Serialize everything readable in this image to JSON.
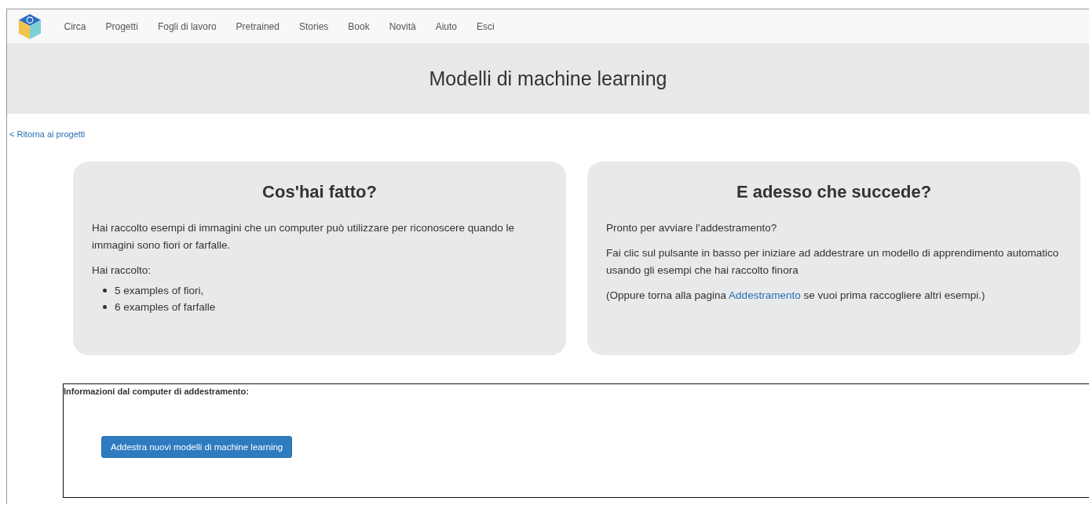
{
  "nav": {
    "items": [
      "Circa",
      "Progetti",
      "Fogli di lavoro",
      "Pretrained",
      "Stories",
      "Book",
      "Novità",
      "Aiuto",
      "Esci"
    ]
  },
  "header": {
    "title": "Modelli di machine learning"
  },
  "back_link": "< Ritorna ai progetti",
  "cards": [
    {
      "title": "Cos'hai fatto?",
      "paragraphs": [
        {
          "text": "Hai raccolto esempi di immagini che un computer può utilizzare per riconoscere quando le immagini sono fiori or farfalle."
        },
        {
          "text": "Hai raccolto:"
        }
      ],
      "list": [
        "5 examples of fiori,",
        "6 examples of farfalle"
      ]
    },
    {
      "title": "E adesso che succede?",
      "paragraphs": [
        {
          "text": "Pronto per avviare l'addestramento?"
        },
        {
          "text": "Fai clic sul pulsante in basso per iniziare ad addestrare un modello di apprendimento automatico usando gli esempi che hai raccolto finora"
        },
        {
          "text": "(Oppure torna alla pagina ",
          "link": "Addestramento",
          "after": " se vuoi prima raccogliere altri esempi.)"
        }
      ]
    }
  ],
  "training": {
    "label": "Informazioni dal computer di addestramento:",
    "button": "Addestra nuovi modelli di machine learning"
  }
}
